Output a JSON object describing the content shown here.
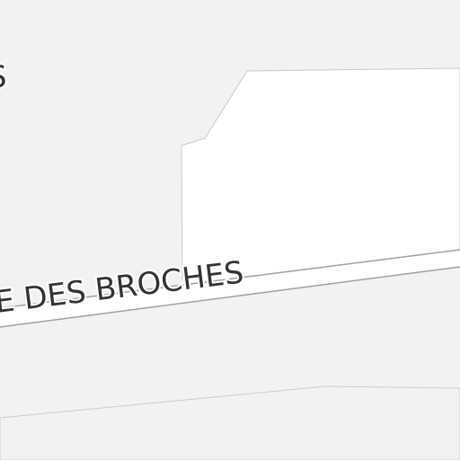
{
  "map": {
    "colors": {
      "background": "#f2f2f2",
      "area": "#ffffff",
      "road": "#ffffff",
      "road_casing": "#a0a0a0",
      "label": "#333333"
    },
    "labels": {
      "street": "E DES BROCHES",
      "partial_top_left": "S"
    }
  }
}
